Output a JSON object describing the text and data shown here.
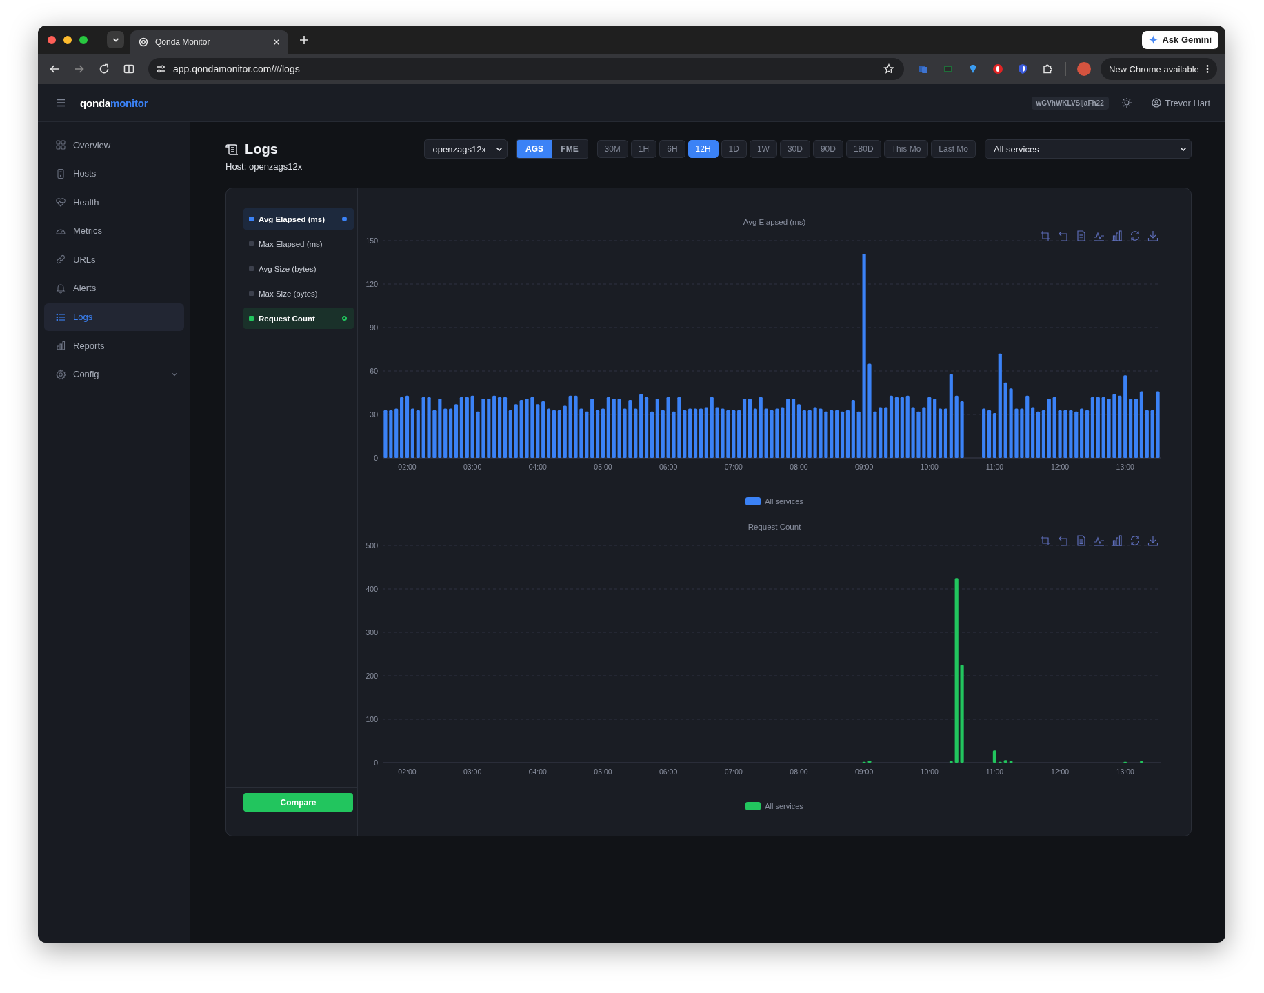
{
  "browser": {
    "tab_title": "Qonda Monitor",
    "url": "app.qondamonitor.com/#/logs",
    "gemini_button": "Ask Gemini",
    "update_button": "New Chrome available"
  },
  "app_header": {
    "logo_part_1": "qonda",
    "logo_part_2": "monitor",
    "token": "wGVhWKLVSIjaFh22",
    "user": "Trevor Hart"
  },
  "sidebar": {
    "items": [
      {
        "label": "Overview",
        "selected": false
      },
      {
        "label": "Hosts",
        "selected": false
      },
      {
        "label": "Health",
        "selected": false
      },
      {
        "label": "Metrics",
        "selected": false
      },
      {
        "label": "URLs",
        "selected": false
      },
      {
        "label": "Alerts",
        "selected": false
      },
      {
        "label": "Logs",
        "selected": true
      },
      {
        "label": "Reports",
        "selected": false
      },
      {
        "label": "Config",
        "selected": false,
        "expanded": false
      }
    ]
  },
  "page": {
    "title": "Logs",
    "subtitle": "Host: openzags12x"
  },
  "filters": {
    "host_select": "openzags12x",
    "modes": [
      {
        "label": "AGS",
        "selected": true
      },
      {
        "label": "FME",
        "selected": false
      }
    ],
    "ranges": [
      {
        "label": "30M",
        "selected": false
      },
      {
        "label": "1H",
        "selected": false
      },
      {
        "label": "6H",
        "selected": false
      },
      {
        "label": "12H",
        "selected": true
      },
      {
        "label": "1D",
        "selected": false
      },
      {
        "label": "1W",
        "selected": false
      },
      {
        "label": "30D",
        "selected": false
      },
      {
        "label": "90D",
        "selected": false
      },
      {
        "label": "180D",
        "selected": false
      },
      {
        "label": "This Mo",
        "selected": false
      },
      {
        "label": "Last Mo",
        "selected": false
      }
    ],
    "service_select": "All services"
  },
  "series_list": {
    "items": [
      {
        "label": "Avg Elapsed (ms)",
        "color": "#3b82f6",
        "selected": true,
        "kind": "dot"
      },
      {
        "label": "Max Elapsed (ms)",
        "color": "#3d414d",
        "selected": false,
        "kind": "plain"
      },
      {
        "label": "Avg Size (bytes)",
        "color": "#3d414d",
        "selected": false,
        "kind": "plain"
      },
      {
        "label": "Max Size (bytes)",
        "color": "#3d414d",
        "selected": false,
        "kind": "plain"
      },
      {
        "label": "Request Count",
        "color": "#22c55e",
        "selected": true,
        "kind": "ring"
      }
    ],
    "compare_button": "Compare"
  },
  "charts": [
    {
      "chart_data": {
        "type": "bar",
        "title": "Avg Elapsed (ms)",
        "grid": true,
        "x": [
          100,
          105,
          110,
          115,
          120,
          125,
          130,
          135,
          140,
          145,
          150,
          155,
          160,
          165,
          170,
          175,
          180,
          185,
          190,
          195,
          200,
          205,
          210,
          215,
          220,
          225,
          230,
          235,
          240,
          245,
          250,
          255,
          260,
          265,
          270,
          275,
          280,
          285,
          290,
          295,
          300,
          305,
          310,
          315,
          320,
          325,
          330,
          335,
          340,
          345,
          350,
          355,
          360,
          365,
          370,
          375,
          380,
          385,
          390,
          395,
          400,
          405,
          410,
          415,
          420,
          425,
          430,
          435,
          440,
          445,
          450,
          455,
          460,
          465,
          470,
          475,
          480,
          485,
          490,
          495,
          500,
          505,
          510,
          515,
          520,
          525,
          530,
          535,
          540,
          545,
          550,
          555,
          560,
          565,
          570,
          575,
          580,
          585,
          590,
          595,
          600,
          605,
          610,
          615,
          620,
          625,
          630,
          650,
          655,
          660,
          665,
          670,
          675,
          680,
          685,
          690,
          695,
          700,
          705,
          710,
          715,
          720,
          725,
          730,
          735,
          740,
          745,
          750,
          755,
          760,
          765,
          770,
          775,
          780,
          785,
          790,
          795,
          800,
          805,
          810
        ],
        "series": [
          {
            "name": "All services",
            "color": "#3b82f6",
            "values": [
              33,
              33,
              34,
              42,
              43,
              34,
              33,
              42,
              42,
              33,
              41,
              34,
              34,
              37,
              42,
              42,
              43,
              32,
              41,
              41,
              43,
              42,
              42,
              33,
              37,
              40,
              41,
              42,
              37,
              39,
              34,
              33,
              33,
              36,
              43,
              43,
              34,
              32,
              41,
              33,
              34,
              42,
              41,
              41,
              34,
              40,
              34,
              44,
              42,
              32,
              41,
              33,
              42,
              32,
              42,
              33,
              34,
              34,
              34,
              35,
              42,
              35,
              34,
              33,
              33,
              33,
              41,
              41,
              34,
              42,
              34,
              33,
              34,
              35,
              41,
              41,
              37,
              33,
              33,
              35,
              34,
              32,
              33,
              33,
              32,
              33,
              40,
              32,
              141,
              65,
              32,
              35,
              35,
              43,
              42,
              42,
              43,
              35,
              32,
              35,
              42,
              41,
              34,
              34,
              58,
              43,
              39,
              34,
              33,
              31,
              72,
              52,
              48,
              34,
              34,
              43,
              35,
              32,
              33,
              41,
              42,
              33,
              33,
              33,
              32,
              34,
              33,
              42,
              42,
              42,
              41,
              44,
              43,
              57,
              41,
              41,
              46,
              33,
              33,
              46
            ]
          }
        ],
        "xlim": [
          97.5,
          812.5
        ],
        "ylim": [
          0,
          150
        ],
        "yticks": [
          0,
          30,
          60,
          90,
          120,
          150
        ],
        "xticks": [
          {
            "value": 120,
            "label": "02:00"
          },
          {
            "value": 180,
            "label": "03:00"
          },
          {
            "value": 240,
            "label": "04:00"
          },
          {
            "value": 300,
            "label": "05:00"
          },
          {
            "value": 360,
            "label": "06:00"
          },
          {
            "value": 420,
            "label": "07:00"
          },
          {
            "value": 480,
            "label": "08:00"
          },
          {
            "value": 540,
            "label": "09:00"
          },
          {
            "value": 600,
            "label": "10:00"
          },
          {
            "value": 660,
            "label": "11:00"
          },
          {
            "value": 720,
            "label": "12:00"
          },
          {
            "value": 780,
            "label": "13:00"
          }
        ]
      }
    },
    {
      "chart_data": {
        "type": "bar",
        "title": "Request Count",
        "grid": true,
        "x": [
          100,
          105,
          110,
          115,
          120,
          125,
          130,
          135,
          140,
          145,
          150,
          155,
          160,
          165,
          170,
          175,
          180,
          185,
          190,
          195,
          200,
          205,
          210,
          215,
          220,
          225,
          230,
          235,
          240,
          245,
          250,
          255,
          260,
          265,
          270,
          275,
          280,
          285,
          290,
          295,
          300,
          305,
          310,
          315,
          320,
          325,
          330,
          335,
          340,
          345,
          350,
          355,
          360,
          365,
          370,
          375,
          380,
          385,
          390,
          395,
          400,
          405,
          410,
          415,
          420,
          425,
          430,
          435,
          440,
          445,
          450,
          455,
          460,
          465,
          470,
          475,
          480,
          485,
          490,
          495,
          500,
          505,
          510,
          515,
          520,
          525,
          530,
          535,
          540,
          545,
          550,
          555,
          560,
          565,
          570,
          575,
          580,
          585,
          590,
          595,
          600,
          605,
          610,
          615,
          620,
          625,
          630,
          650,
          655,
          660,
          665,
          670,
          675,
          680,
          685,
          690,
          695,
          700,
          705,
          710,
          715,
          720,
          725,
          730,
          735,
          740,
          745,
          750,
          755,
          760,
          765,
          770,
          775,
          780,
          785,
          790,
          795,
          800,
          805,
          810
        ],
        "series": [
          {
            "name": "All services",
            "color": "#22c55e",
            "values": [
              0,
              0,
              0,
              0,
              0,
              0,
              0,
              0,
              0,
              0,
              0,
              0,
              0,
              0,
              0,
              0,
              0,
              0,
              0,
              0,
              0,
              0,
              0,
              0,
              0,
              0,
              0,
              0,
              0,
              0,
              0,
              0,
              0,
              0,
              0,
              0,
              0,
              0,
              0,
              0,
              0,
              0,
              0,
              0,
              0,
              0,
              0,
              0,
              0,
              0,
              0,
              0,
              0,
              0,
              0,
              0,
              0,
              0,
              0,
              0,
              0,
              0,
              0,
              0,
              0,
              0,
              0,
              0,
              0,
              0,
              0,
              0,
              0,
              0,
              0,
              0,
              0,
              0,
              0,
              0,
              0,
              0,
              0,
              0,
              0,
              0,
              0,
              0,
              2,
              4,
              0,
              0,
              0,
              0,
              0,
              0,
              0,
              0,
              0,
              0,
              0,
              0,
              0,
              0,
              3,
              425,
              225,
              0,
              0,
              28,
              2,
              6,
              3,
              0,
              0,
              0,
              0,
              0,
              0,
              0,
              0,
              0,
              0,
              0,
              0,
              0,
              0,
              0,
              0,
              0,
              0,
              0,
              0,
              2,
              0,
              0,
              3,
              0,
              0,
              0
            ]
          }
        ],
        "xlim": [
          97.5,
          812.5
        ],
        "ylim": [
          0,
          500
        ],
        "yticks": [
          0,
          100,
          200,
          300,
          400,
          500
        ],
        "xticks": [
          {
            "value": 120,
            "label": "02:00"
          },
          {
            "value": 180,
            "label": "03:00"
          },
          {
            "value": 240,
            "label": "04:00"
          },
          {
            "value": 300,
            "label": "05:00"
          },
          {
            "value": 360,
            "label": "06:00"
          },
          {
            "value": 420,
            "label": "07:00"
          },
          {
            "value": 480,
            "label": "08:00"
          },
          {
            "value": 540,
            "label": "09:00"
          },
          {
            "value": 600,
            "label": "10:00"
          },
          {
            "value": 660,
            "label": "11:00"
          },
          {
            "value": 720,
            "label": "12:00"
          },
          {
            "value": 780,
            "label": "13:00"
          }
        ]
      }
    }
  ]
}
